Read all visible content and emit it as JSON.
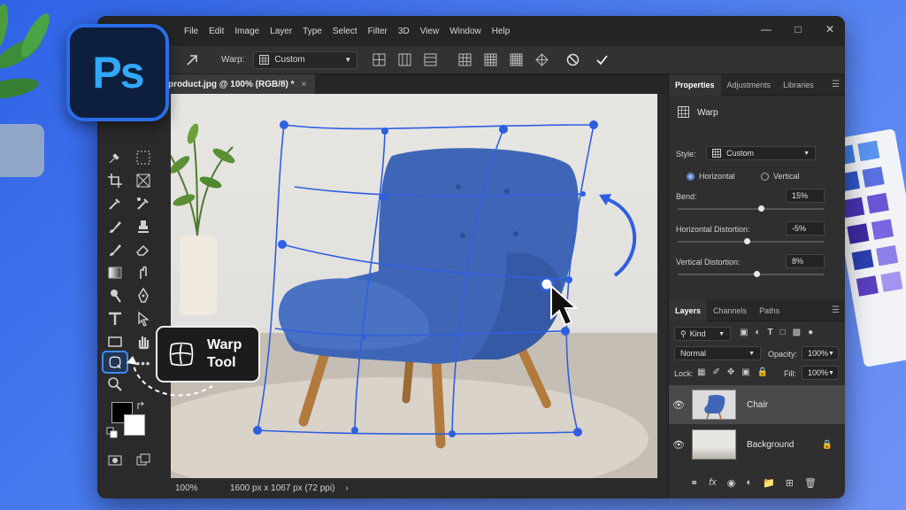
{
  "app": {
    "logo_text": "Ps",
    "menu": [
      "File",
      "Edit",
      "Image",
      "Layer",
      "Type",
      "Select",
      "Filter",
      "3D",
      "View",
      "Window",
      "Help"
    ]
  },
  "options_bar": {
    "warp_label": "Warp:",
    "warp_value": "Custom"
  },
  "document": {
    "tab_title": "product.jpg @ 100% (RGB/8) *",
    "tab_close": "×",
    "zoom": "100%",
    "dimensions": "1600 px x 1067 px (72 ppi)",
    "status_arrow": "›"
  },
  "tooltip": {
    "line1": "Warp",
    "line2": "Tool"
  },
  "properties": {
    "tabs": [
      "Properties",
      "Adjustments",
      "Libraries"
    ],
    "header": "Warp",
    "style_label": "Style:",
    "style_value": "Custom",
    "orientation": {
      "horizontal": "Horizontal",
      "vertical": "Vertical",
      "selected": "horizontal"
    },
    "bend_label": "Bend:",
    "bend_value": "15%",
    "bend_level": 0.57,
    "hdist_label": "Horizontal Distortion:",
    "hdist_value": "-5%",
    "hdist_level": 0.47,
    "vdist_label": "Vertical Distortion:",
    "vdist_value": "8%",
    "vdist_level": 0.54
  },
  "layers_panel": {
    "tabs": [
      "Layers",
      "Channels",
      "Paths"
    ],
    "filter_value": "Kind",
    "blend_mode": "Normal",
    "opacity_label": "Opacity:",
    "opacity_value": "100%",
    "lock_label": "Lock:",
    "fill_label": "Fill:",
    "fill_value": "100%",
    "layers": [
      {
        "name": "Chair",
        "selected": true
      },
      {
        "name": "Background",
        "locked": true
      }
    ]
  },
  "colors": {
    "accent": "#2b6de8",
    "warp_mesh": "#2f5fe0",
    "chair": "#3d63b4",
    "panel_bg": "#2f2f2f"
  }
}
